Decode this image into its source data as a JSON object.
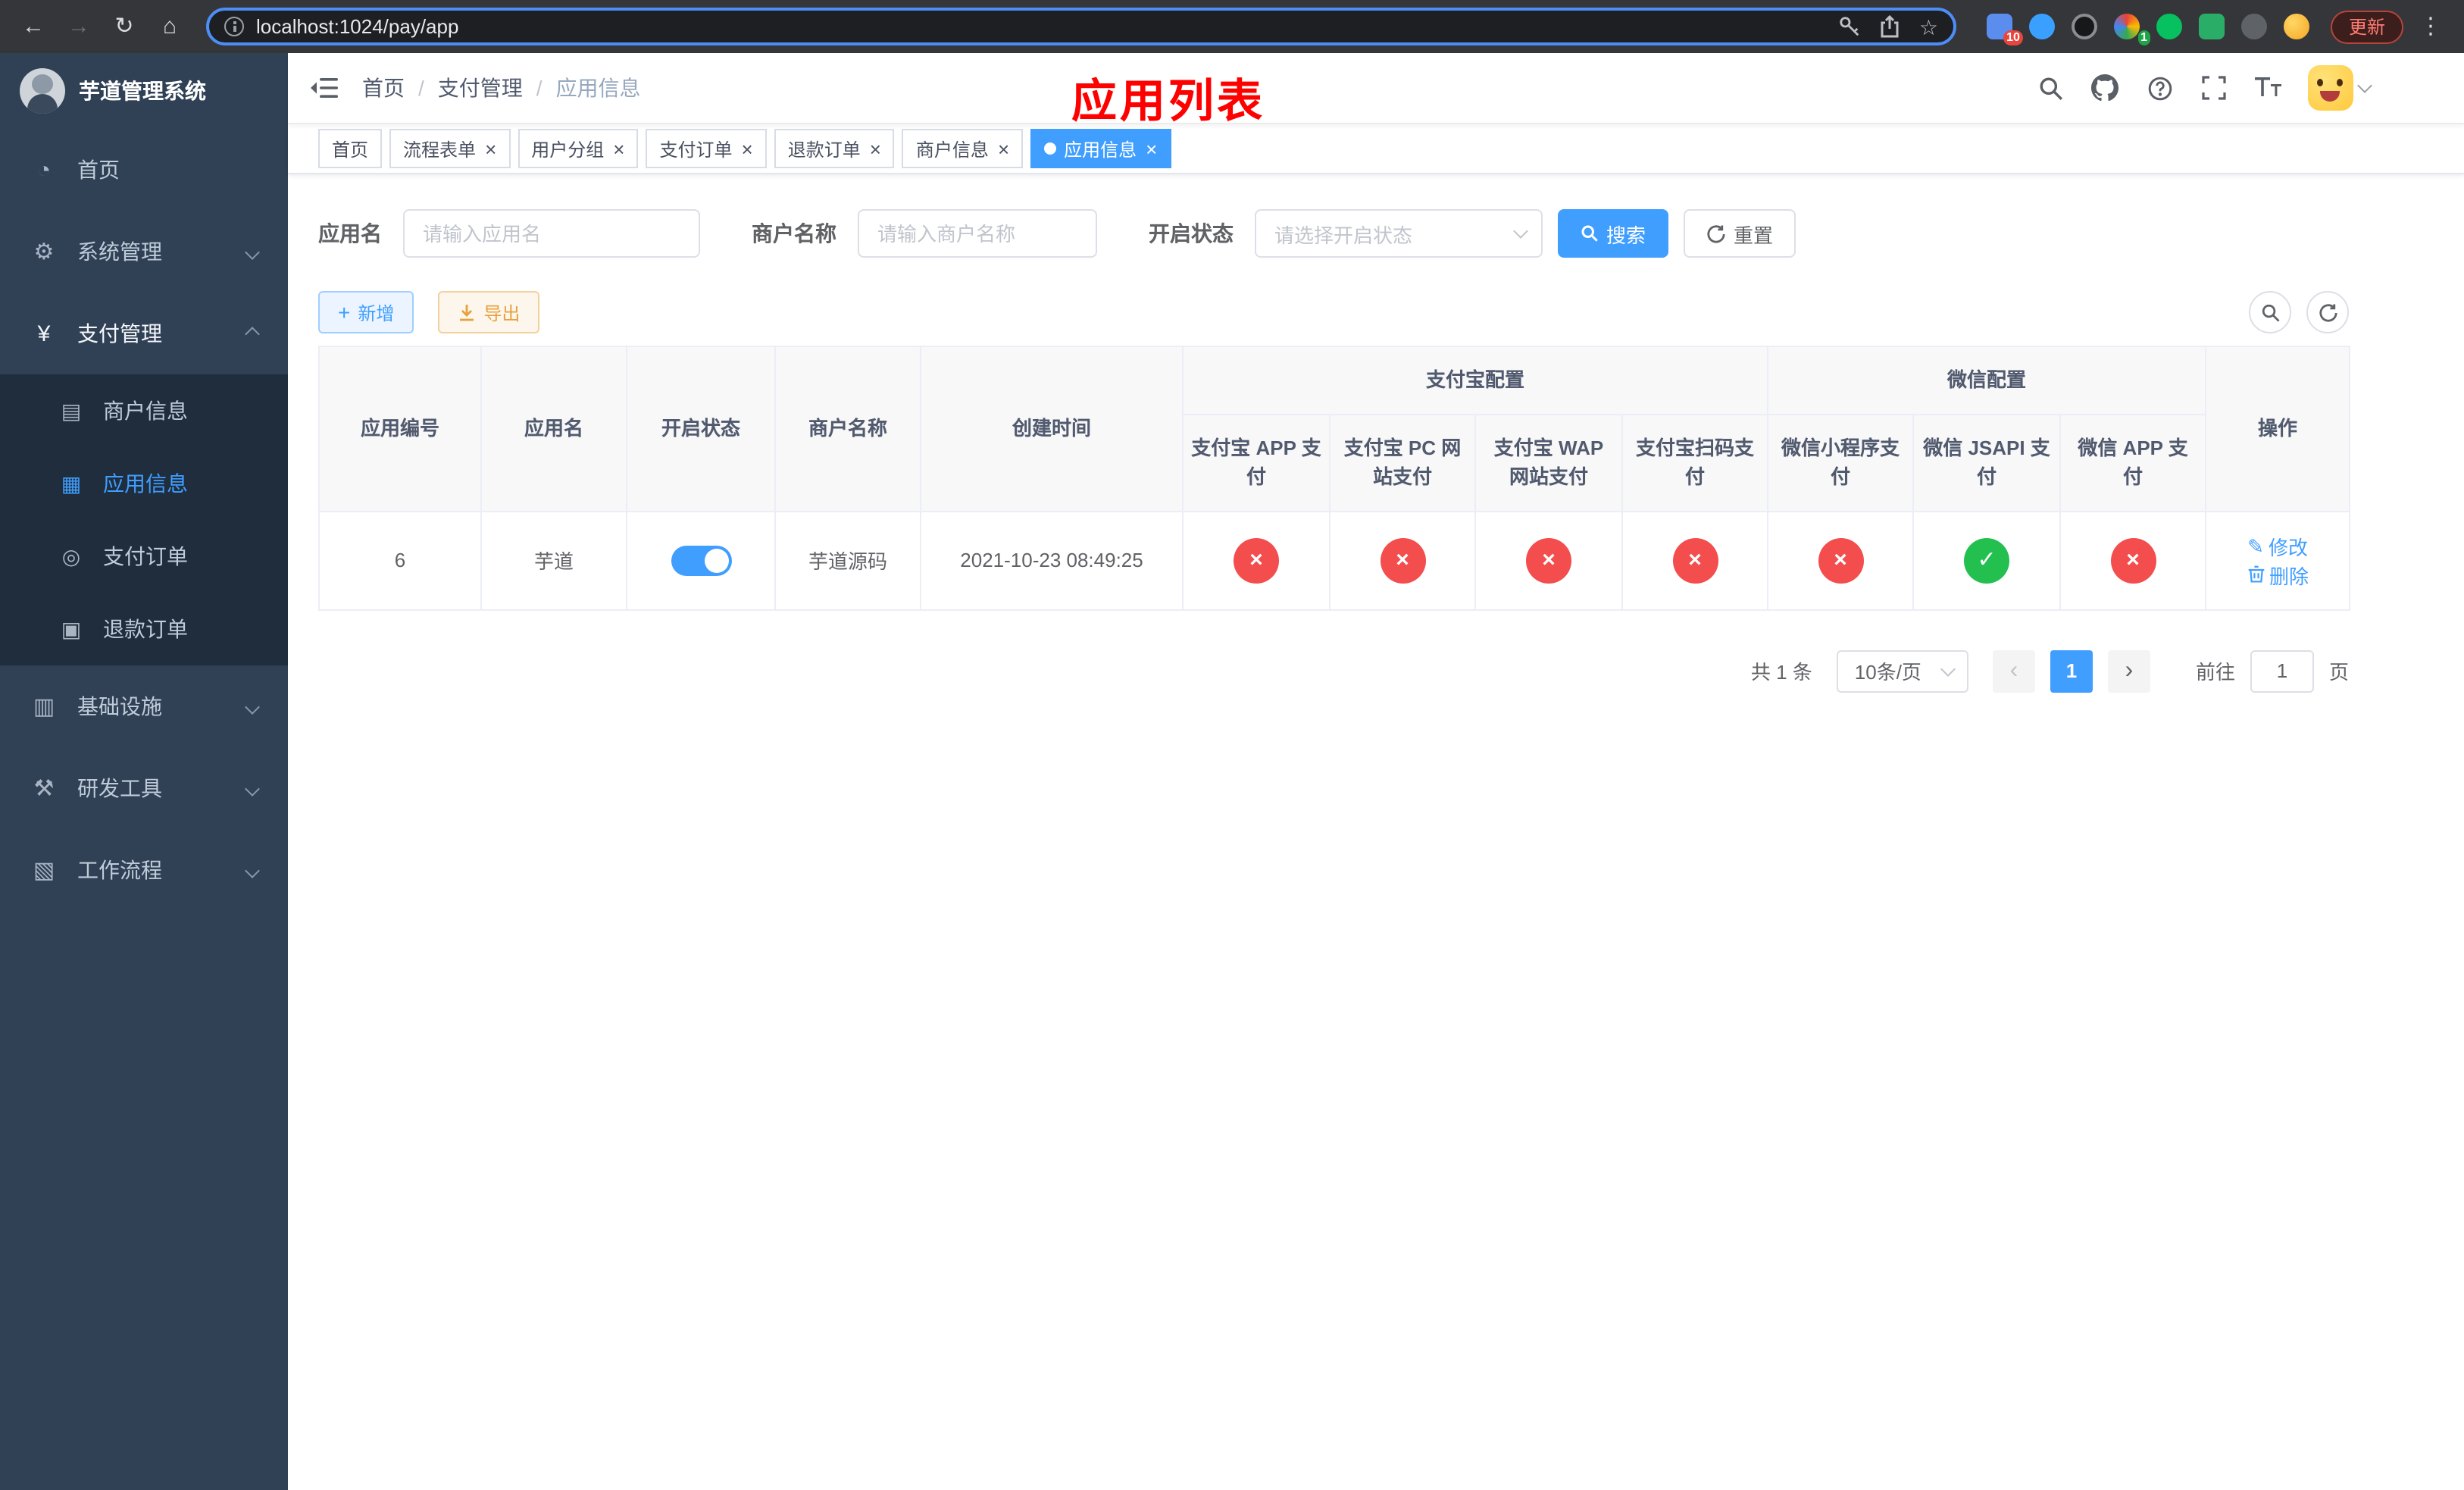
{
  "browser": {
    "url": "localhost:1024/pay/app",
    "update_label": "更新",
    "extension_badge_red": "10",
    "extension_badge_green": "1"
  },
  "app_title": "芋道管理系统",
  "sidebar": {
    "items": [
      {
        "label": "首页"
      },
      {
        "label": "系统管理"
      },
      {
        "label": "支付管理"
      },
      {
        "label": "商户信息"
      },
      {
        "label": "应用信息"
      },
      {
        "label": "支付订单"
      },
      {
        "label": "退款订单"
      },
      {
        "label": "基础设施"
      },
      {
        "label": "研发工具"
      },
      {
        "label": "工作流程"
      }
    ]
  },
  "breadcrumb": {
    "separator": "/",
    "items": [
      "首页",
      "支付管理",
      "应用信息"
    ]
  },
  "page_title": "应用列表",
  "tabs": [
    {
      "label": "首页",
      "closable": false,
      "active": false
    },
    {
      "label": "流程表单",
      "closable": true,
      "active": false
    },
    {
      "label": "用户分组",
      "closable": true,
      "active": false
    },
    {
      "label": "支付订单",
      "closable": true,
      "active": false
    },
    {
      "label": "退款订单",
      "closable": true,
      "active": false
    },
    {
      "label": "商户信息",
      "closable": true,
      "active": false
    },
    {
      "label": "应用信息",
      "closable": true,
      "active": true
    }
  ],
  "filters": {
    "app_name_label": "应用名",
    "app_name_placeholder": "请输入应用名",
    "merchant_label": "商户名称",
    "merchant_placeholder": "请输入商户名称",
    "status_label": "开启状态",
    "status_placeholder": "请选择开启状态",
    "search_label": "搜索",
    "reset_label": "重置"
  },
  "toolbar": {
    "add_label": "新增",
    "export_label": "导出"
  },
  "table": {
    "columns": {
      "app_id": "应用编号",
      "app_name": "应用名",
      "status": "开启状态",
      "merchant": "商户名称",
      "created": "创建时间",
      "actions": "操作",
      "alipay_group": "支付宝配置",
      "wechat_group": "微信配置",
      "alipay_app": "支付宝 APP 支付",
      "alipay_pc": "支付宝 PC 网站支付",
      "alipay_wap": "支付宝 WAP 网站支付",
      "alipay_qr": "支付宝扫码支付",
      "wechat_mini": "微信小程序支付",
      "wechat_jsapi": "微信 JSAPI 支付",
      "wechat_app": "微信 APP 支付"
    },
    "rows": [
      {
        "app_id": "6",
        "app_name": "芋道",
        "status_on": true,
        "merchant": "芋道源码",
        "created": "2021-10-23 08:49:25",
        "alipay_app": "disabled",
        "alipay_pc": "disabled",
        "alipay_wap": "disabled",
        "alipay_qr": "disabled",
        "wechat_mini": "disabled",
        "wechat_jsapi": "enabled",
        "wechat_app": "disabled",
        "edit_label": "修改",
        "delete_label": "删除"
      }
    ]
  },
  "pagination": {
    "total_label": "共 1 条",
    "page_size_label": "10条/页",
    "current_page": "1",
    "goto_label": "前往",
    "goto_value": "1",
    "unit_label": "页"
  },
  "icons": {
    "back": "←",
    "forward": "→",
    "reload": "↻",
    "home": "⌂",
    "star": "☆",
    "overflow_menu": "⋮",
    "close": "×",
    "nav_dashboard": "◔",
    "nav_system": "⚙",
    "nav_payment": "¥",
    "nav_merchant": "▤",
    "nav_app": "▦",
    "nav_order": "◎",
    "nav_refund": "▣",
    "nav_infra": "▥",
    "nav_devtool": "⚒",
    "nav_workflow": "▧",
    "plus": "+",
    "edit": "✎",
    "cross": "×",
    "check": "✓",
    "prev": "‹",
    "next": "›"
  },
  "colors": {
    "primary": "#409eff",
    "success": "#23c050",
    "danger": "#f34d4d",
    "warning": "#e6a23c",
    "title_red": "#ff0000",
    "sidebar_bg": "#304156",
    "submenu_bg": "#1f2d3d"
  }
}
